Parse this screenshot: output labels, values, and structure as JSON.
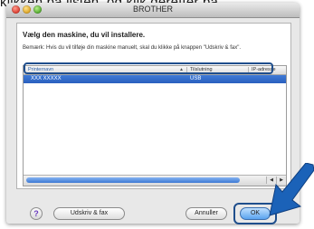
{
  "background_caption": "klikken på listen, og klik derefter på",
  "window": {
    "title": "BROTHER",
    "heading": "Vælg den maskine, du vil installere.",
    "note": "Bemærk: Hvis du vil tilføje din maskine manuelt, skal du klikke på knappen \"Udskriv & fax\"."
  },
  "table": {
    "columns": [
      "Printernavn",
      "Tilslutning",
      "IP-adresse"
    ],
    "rows": [
      {
        "name": "XXX XXXXX",
        "connection": "USB",
        "ip": ""
      }
    ]
  },
  "buttons": {
    "help": "?",
    "print_fax": "Udskriv & fax",
    "cancel": "Annuller",
    "ok": "OK"
  },
  "colors": {
    "selection": "#2f66c6",
    "callout": "#1f4e8c",
    "arrow": "#1b62b8"
  },
  "icons": {
    "help": "question-mark-icon",
    "pointer": "arrow-pointer-icon"
  }
}
